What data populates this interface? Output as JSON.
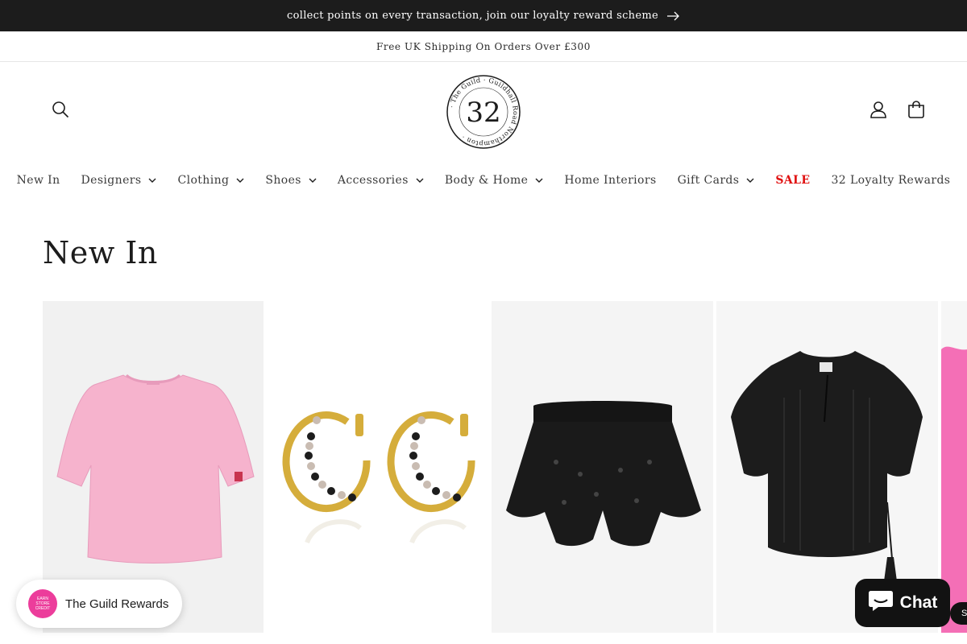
{
  "announcement": {
    "text": "collect points on every transaction, join our loyalty reward scheme",
    "arrow_icon": "arrow-right-icon"
  },
  "shipping_bar": {
    "text": "Free UK Shipping On Orders Over £300"
  },
  "header": {
    "logo": {
      "ring_text": "· The Guild · Guildhall Road Northampton ·",
      "number": "32"
    },
    "icons": [
      "search-icon",
      "account-icon",
      "cart-icon"
    ]
  },
  "nav": {
    "items": [
      {
        "label": "New In",
        "has_dropdown": false
      },
      {
        "label": "Designers",
        "has_dropdown": true
      },
      {
        "label": "Clothing",
        "has_dropdown": true
      },
      {
        "label": "Shoes",
        "has_dropdown": true
      },
      {
        "label": "Accessories",
        "has_dropdown": true
      },
      {
        "label": "Body & Home",
        "has_dropdown": true
      },
      {
        "label": "Home Interiors",
        "has_dropdown": false
      },
      {
        "label": "Gift Cards",
        "has_dropdown": true
      },
      {
        "label": "SALE",
        "has_dropdown": false,
        "highlight": true
      },
      {
        "label": "32 Loyalty Rewards",
        "has_dropdown": false
      }
    ],
    "sale_color": "#e00f0f"
  },
  "section": {
    "title": "New In"
  },
  "products": [
    {
      "image": "pink-tshirt"
    },
    {
      "image": "beaded-gold-hoop-earrings"
    },
    {
      "image": "black-lace-ruffle-shorts"
    },
    {
      "image": "black-lace-blouse"
    },
    {
      "image": "pink-knit-partial"
    }
  ],
  "rewards_widget": {
    "label": "The Guild Rewards",
    "badge_lines": [
      "EARN",
      "STORE",
      "CREDIT"
    ],
    "badge_color": "#ec3d9b"
  },
  "chat_widget": {
    "label": "Chat",
    "edge_label": "S"
  },
  "colors": {
    "announcement_bg": "#1c1c1c",
    "text": "#1c1c1c",
    "chat_bg": "#121212"
  }
}
